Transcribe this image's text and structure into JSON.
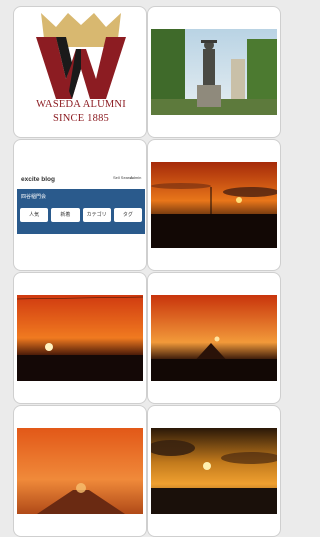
{
  "tiles": {
    "logo": {
      "line1": "WASEDA ALUMNI",
      "line2": "SINCE 1885",
      "colors": {
        "crimson": "#8c1c22",
        "gold": "#c6a75e"
      }
    },
    "blog": {
      "title": "excite blog",
      "icon1": "Sell Search",
      "icon2": "Admin",
      "blog_name": "四谷稲門会",
      "buttons": [
        "人気",
        "新着",
        "カテゴリ",
        "タグ"
      ]
    }
  }
}
